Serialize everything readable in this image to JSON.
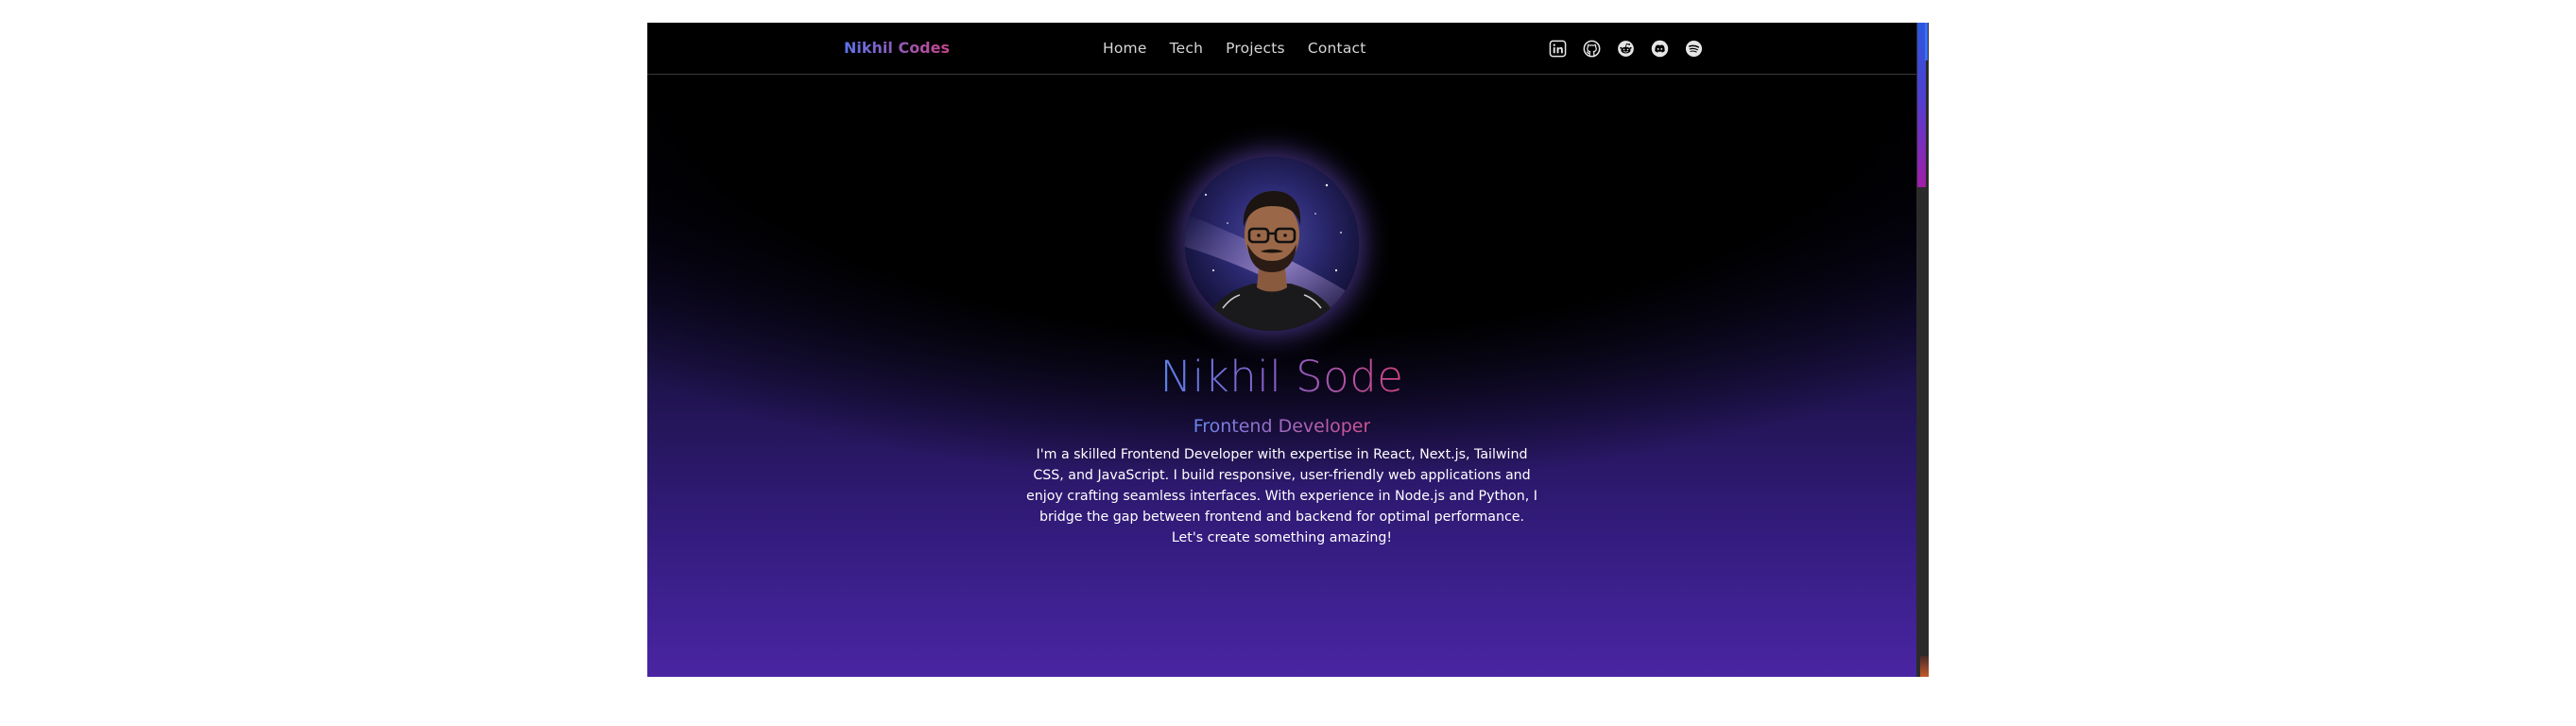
{
  "navbar": {
    "brand": "Nikhil Codes",
    "links": [
      {
        "label": "Home"
      },
      {
        "label": "Tech"
      },
      {
        "label": "Projects"
      },
      {
        "label": "Contact"
      }
    ],
    "icons": [
      "linkedin-icon",
      "github-icon",
      "reddit-icon",
      "discord-icon",
      "spotify-icon"
    ]
  },
  "hero": {
    "name": "Nikhil Sode",
    "role": "Frontend Developer",
    "bio_lines": [
      "I'm a skilled Frontend Developer with expertise in React, Next.js, Tailwind",
      "CSS, and JavaScript. I build responsive, user-friendly web applications and",
      "enjoy crafting seamless interfaces. With experience in Node.js and Python, I",
      "bridge the gap between frontend and backend for optimal performance.",
      "Let's create something amazing!"
    ]
  },
  "colors": {
    "gradient_blue": "#5b73e8",
    "gradient_pink": "#c9448a",
    "background_purple": "#4a25a3",
    "nav_text": "#d6d6d6"
  }
}
